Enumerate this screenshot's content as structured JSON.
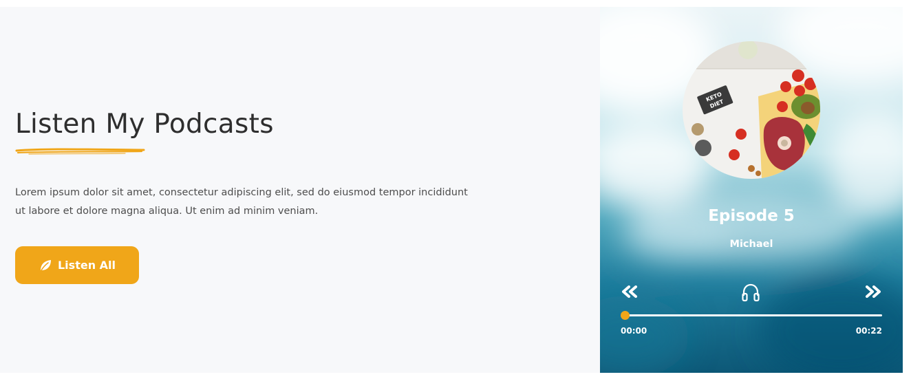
{
  "colors": {
    "accent": "#f0a619",
    "title_text": "#2e2e2e",
    "body_text": "#4d4d4d",
    "section_bg": "#f7f8fa"
  },
  "intro": {
    "title": "Listen My Podcasts",
    "description": "Lorem ipsum dolor sit amet, consectetur adipiscing elit, sed do eiusmod tempor incididunt ut labore et dolore magna aliqua. Ut enim ad minim veniam.",
    "button_label": "Listen All",
    "button_icon": "leaf-icon"
  },
  "player": {
    "episode_title": "Episode 5",
    "author": "Michael",
    "cover_badge": "KETO DIET",
    "progress_fraction": 0,
    "time_current": "00:00",
    "time_total": "00:22",
    "icons": {
      "previous": "double-chevron-left-icon",
      "listen": "headphones-icon",
      "next": "double-chevron-right-icon"
    }
  }
}
